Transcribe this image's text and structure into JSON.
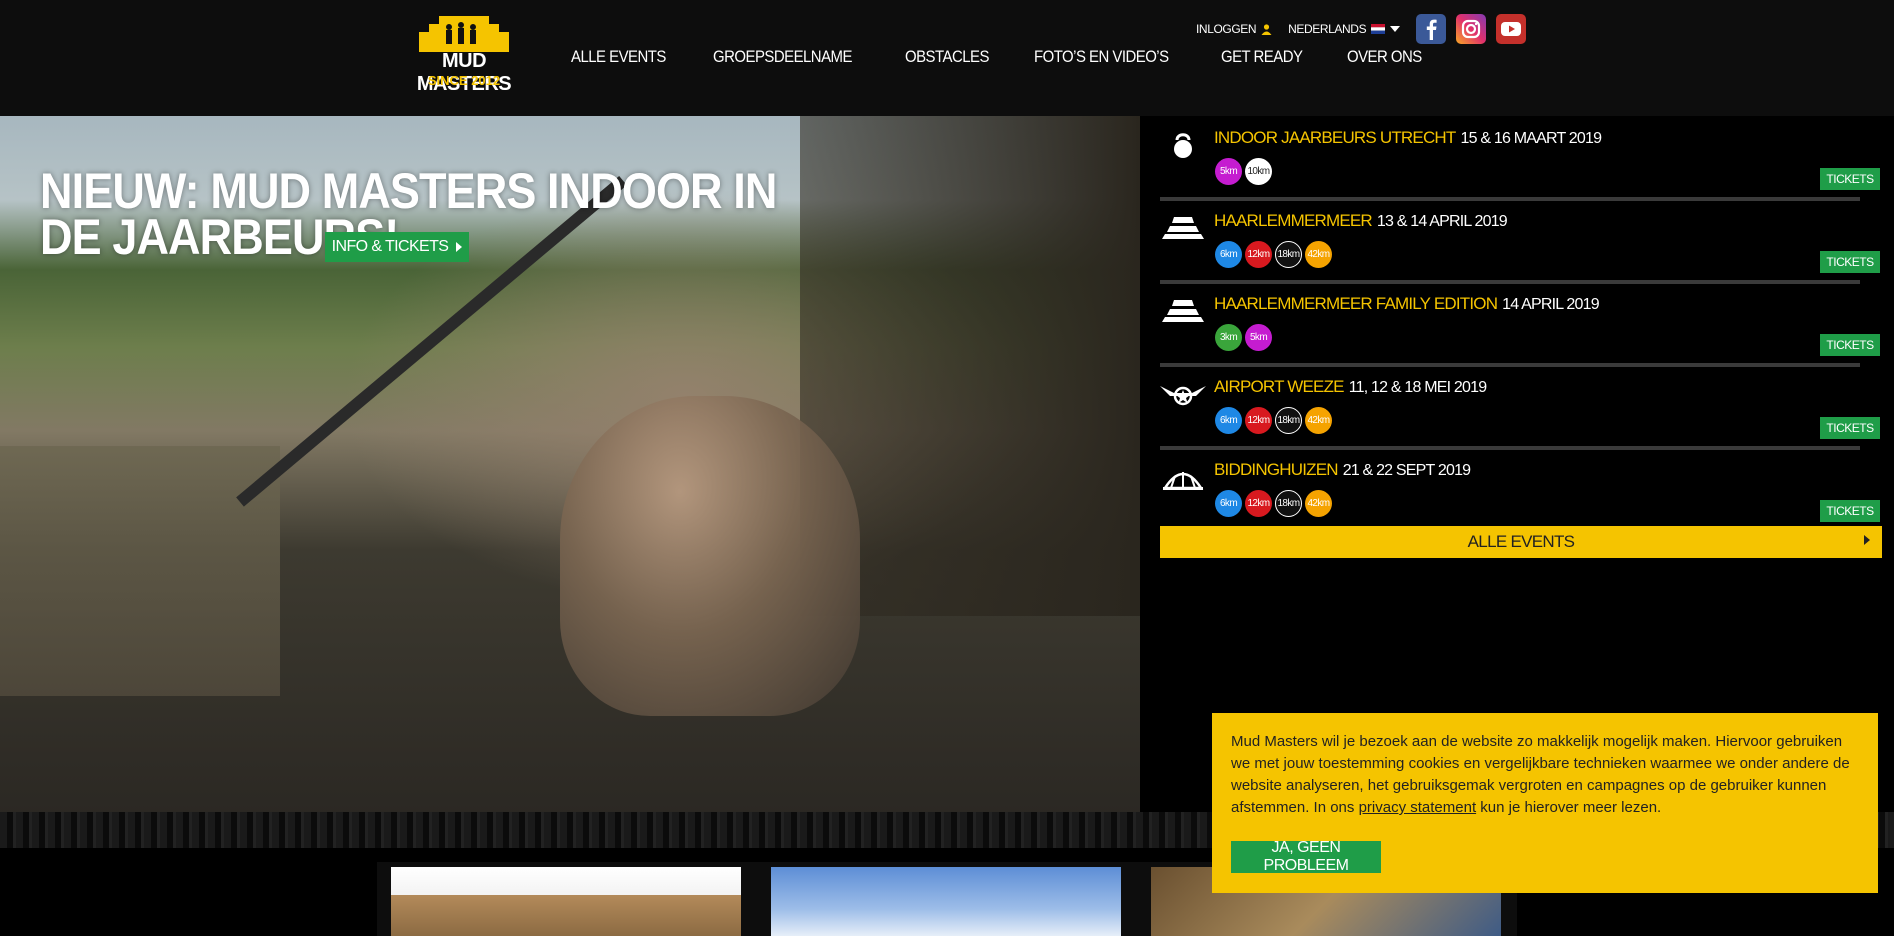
{
  "header": {
    "logo": {
      "title": "MUD MASTERS",
      "subtitle": "SINCE 2012"
    },
    "nav": [
      "ALLE EVENTS",
      "GROEPSDEELNAME",
      "OBSTACLES",
      "FOTO’S EN VIDEO’S",
      "GET READY",
      "OVER ONS"
    ],
    "login_label": "INLOGGEN",
    "language_label": "NEDERLANDS",
    "social": [
      "facebook-icon",
      "instagram-icon",
      "youtube-icon"
    ]
  },
  "hero": {
    "title": "NIEUW: MUD MASTERS INDOOR IN DE JAARBEURS!",
    "button_label": "INFO & TICKETS"
  },
  "events": [
    {
      "icon": "kettlebell-icon",
      "name": "INDOOR JAARBEURS UTRECHT",
      "date": "15 & 16 MAART 2019",
      "badges": [
        {
          "label": "5km",
          "color": "#c51cd0"
        },
        {
          "label": "10km",
          "color": "#ffffff",
          "text": "#222"
        }
      ],
      "ticket_label": "TICKETS"
    },
    {
      "icon": "road-icon",
      "name": "HAARLEMMERMEER",
      "date": "13 & 14 APRIL 2019",
      "badges": [
        {
          "label": "6km",
          "color": "#1e88e5"
        },
        {
          "label": "12km",
          "color": "#d8191f"
        },
        {
          "label": "18km",
          "color": "#111111",
          "text": "#fff"
        },
        {
          "label": "42km",
          "color": "#f5a300"
        }
      ],
      "ticket_label": "TICKETS"
    },
    {
      "icon": "road-icon",
      "name": "HAARLEMMERMEER FAMILY EDITION",
      "date": "14 APRIL 2019",
      "badges": [
        {
          "label": "3km",
          "color": "#3aa53b"
        },
        {
          "label": "5km",
          "color": "#c51cd0"
        }
      ],
      "ticket_label": "TICKETS"
    },
    {
      "icon": "airplane-icon",
      "name": "AIRPORT WEEZE",
      "date": "11, 12 & 18 MEI 2019",
      "badges": [
        {
          "label": "6km",
          "color": "#1e88e5"
        },
        {
          "label": "12km",
          "color": "#d8191f"
        },
        {
          "label": "18km",
          "color": "#111111",
          "text": "#fff"
        },
        {
          "label": "42km",
          "color": "#f5a300"
        }
      ],
      "ticket_label": "TICKETS"
    },
    {
      "icon": "dome-icon",
      "name": "BIDDINGHUIZEN",
      "date": "21 & 22 SEPT 2019",
      "badges": [
        {
          "label": "6km",
          "color": "#1e88e5"
        },
        {
          "label": "12km",
          "color": "#d8191f"
        },
        {
          "label": "18km",
          "color": "#111111",
          "text": "#fff"
        },
        {
          "label": "42km",
          "color": "#f5a300"
        }
      ],
      "ticket_label": "TICKETS"
    }
  ],
  "all_events_label": "ALLE EVENTS",
  "cookie": {
    "text_before": "Mud Masters wil je bezoek aan de website zo makkelijk mogelijk maken. Hiervoor gebruiken we met jouw toestemming cookies en vergelijkbare technieken waarmee we onder andere de website analyseren, het gebruiksgemak vergroten en campagnes op de gebruiker kunnen afstemmen. In ons ",
    "link_text": "privacy statement",
    "text_after": " kun je hierover meer lezen.",
    "button_label": "JA, GEEN PROBLEEM"
  },
  "colors": {
    "accent": "#f5c400",
    "green": "#1f9d48",
    "header_bg": "#0d0d0d"
  }
}
